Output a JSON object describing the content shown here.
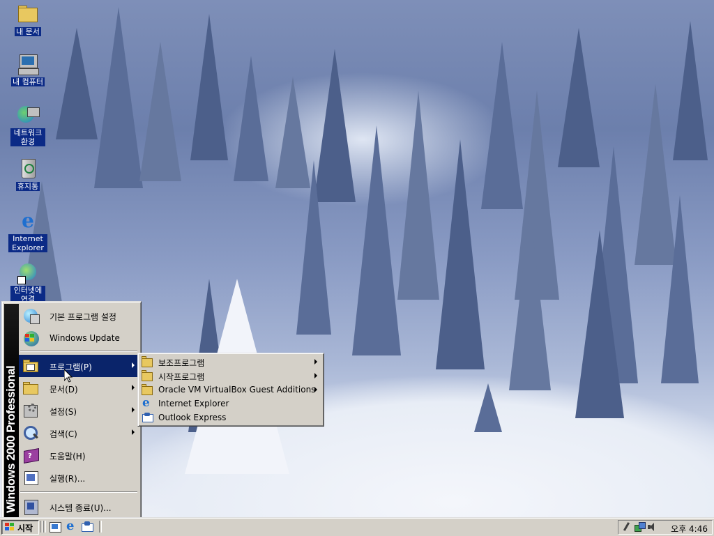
{
  "desktop": {
    "icons": [
      {
        "label": "내 문서",
        "icon": "my-documents-icon"
      },
      {
        "label": "내 컴퓨터",
        "icon": "my-computer-icon"
      },
      {
        "label": "네트워크 환경",
        "icon": "network-places-icon"
      },
      {
        "label": "휴지통",
        "icon": "recycle-bin-icon"
      },
      {
        "label": "Internet Explorer",
        "icon": "internet-explorer-icon"
      },
      {
        "label": "인터넷에 연결",
        "icon": "connect-to-internet-icon"
      }
    ]
  },
  "start_menu": {
    "banner": "Windows 2000 Professional",
    "items": [
      {
        "label": "기본 프로그램 설정",
        "icon": "default-programs-icon",
        "submenu": false
      },
      {
        "label": "Windows Update",
        "icon": "windows-update-icon",
        "submenu": false
      },
      {
        "label": "프로그램(P)",
        "icon": "programs-folder-icon",
        "submenu": true,
        "highlighted": true
      },
      {
        "label": "문서(D)",
        "icon": "documents-folder-icon",
        "submenu": true
      },
      {
        "label": "설정(S)",
        "icon": "settings-icon",
        "submenu": true
      },
      {
        "label": "검색(C)",
        "icon": "search-icon",
        "submenu": true
      },
      {
        "label": "도움말(H)",
        "icon": "help-book-icon",
        "submenu": false
      },
      {
        "label": "실행(R)...",
        "icon": "run-icon",
        "submenu": false
      },
      {
        "label": "시스템 종료(U)...",
        "icon": "shutdown-icon",
        "submenu": false
      }
    ]
  },
  "programs_menu": {
    "items": [
      {
        "label": "보조프로그램",
        "icon": "program-group-icon",
        "submenu": true
      },
      {
        "label": "시작프로그램",
        "icon": "program-group-icon",
        "submenu": true
      },
      {
        "label": "Oracle VM VirtualBox Guest Additions",
        "icon": "program-group-icon",
        "submenu": true
      },
      {
        "label": "Internet Explorer",
        "icon": "internet-explorer-icon",
        "submenu": false
      },
      {
        "label": "Outlook Express",
        "icon": "outlook-express-icon",
        "submenu": false
      }
    ]
  },
  "taskbar": {
    "start_label": "시작",
    "quick_launch": [
      "show-desktop-icon",
      "internet-explorer-icon",
      "outlook-express-icon"
    ],
    "tray_icons": [
      "pen-icon",
      "network-icon",
      "volume-icon"
    ],
    "clock": "오후 4:46"
  },
  "colors": {
    "highlight": "#0a246a",
    "face": "#d4d0c8",
    "desktop_label_bg": "#0b2a86"
  }
}
